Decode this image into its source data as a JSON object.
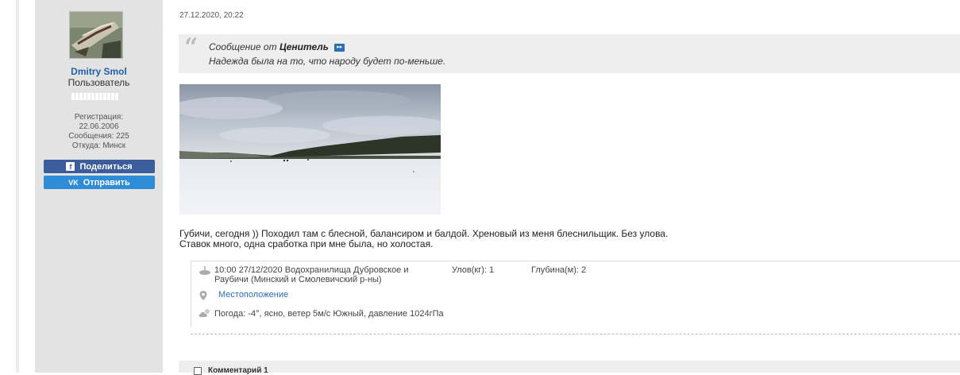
{
  "user": {
    "name": "Dmitry Smol",
    "role": "Пользователь",
    "registration_label": "Регистрация:",
    "registration_date": "22.06.2006",
    "messages": "Сообщения: 225",
    "location": "Откуда: Минск"
  },
  "share": {
    "facebook_label": "Поделиться",
    "vk_label": "Отправить",
    "facebook_icon": "f",
    "vk_icon": "VK"
  },
  "post": {
    "date": "27.12.2020, 20:22",
    "quote": {
      "prefix": "Сообщение от",
      "author": "Ценитель",
      "text": "Надежда была на то, что народу будет по-меньше."
    },
    "text_line1": "Губичи, сегодня )) Походил там с блесной, балансиром и балдой. Хреновый из меня блеснильщик. Без улова.",
    "text_line2": "Ставок много, одна сработка при мне была, но холостая."
  },
  "catch": {
    "line1": "10:00 27/12/2020 Водохранилища Дубровское и",
    "line2": "Раубичи (Минский и Смолевичский р-ны)",
    "catch_label": "Улов(кг): 1",
    "depth_label": "Глубина(м): 2",
    "location_link": "Местоположение",
    "weather": "Погода: -4°, ясно, ветер 5м/с Южный, давление 1024гПа"
  },
  "comments": {
    "label": "Комментарий 1"
  },
  "colors": {
    "sidebar": "#e3e3e3",
    "username": "#1f62a8",
    "facebook": "#3b5d9c",
    "vk": "#2f8dd8",
    "link": "#2a6fb5"
  }
}
